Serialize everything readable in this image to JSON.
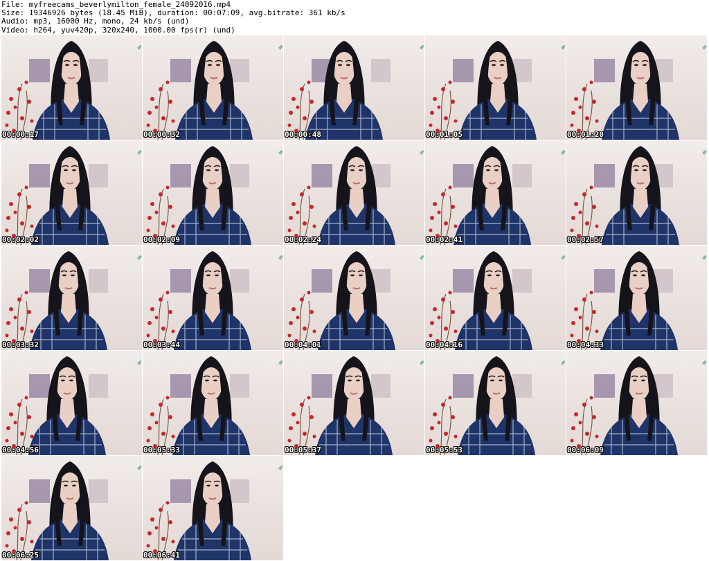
{
  "header": {
    "file_line": "File: myfreecams_beverlymilton_female_24092016.mp4",
    "size_line": "Size: 19346926 bytes (18.45 MiB), duration: 00:07:09, avg.bitrate: 361 kb/s",
    "audio_line": "Audio: mp3, 16000 Hz, mono, 24 kb/s (und)",
    "video_line": "Video: h264, yuv420p, 320x240, 1000.00 fps(r) (und)"
  },
  "frames": [
    {
      "timestamp": "00:00:17"
    },
    {
      "timestamp": "00:00:32"
    },
    {
      "timestamp": "00:00:48"
    },
    {
      "timestamp": "00:01:05"
    },
    {
      "timestamp": "00:01:20"
    },
    {
      "timestamp": "00:02:02"
    },
    {
      "timestamp": "00:02:09"
    },
    {
      "timestamp": "00:02:24"
    },
    {
      "timestamp": "00:02:41"
    },
    {
      "timestamp": "00:02:57"
    },
    {
      "timestamp": "00:03:32"
    },
    {
      "timestamp": "00:03:44"
    },
    {
      "timestamp": "00:04:01"
    },
    {
      "timestamp": "00:04:16"
    },
    {
      "timestamp": "00:04:33"
    },
    {
      "timestamp": "00:04:56"
    },
    {
      "timestamp": "00:05:33"
    },
    {
      "timestamp": "00:05:37"
    },
    {
      "timestamp": "00:05:53"
    },
    {
      "timestamp": "00:06:09"
    },
    {
      "timestamp": "00:06:25"
    },
    {
      "timestamp": "00:06:41"
    }
  ],
  "colors": {
    "wall": "#ece4e1",
    "hair": "#15141a",
    "skin": "#e9cfc4",
    "shirt": "#1f3468",
    "shirt_check": "#c9d2e6",
    "flower_red": "#c2282e",
    "frame_picture": "#9a8aa6",
    "timestamp_text": "#ffffff"
  }
}
